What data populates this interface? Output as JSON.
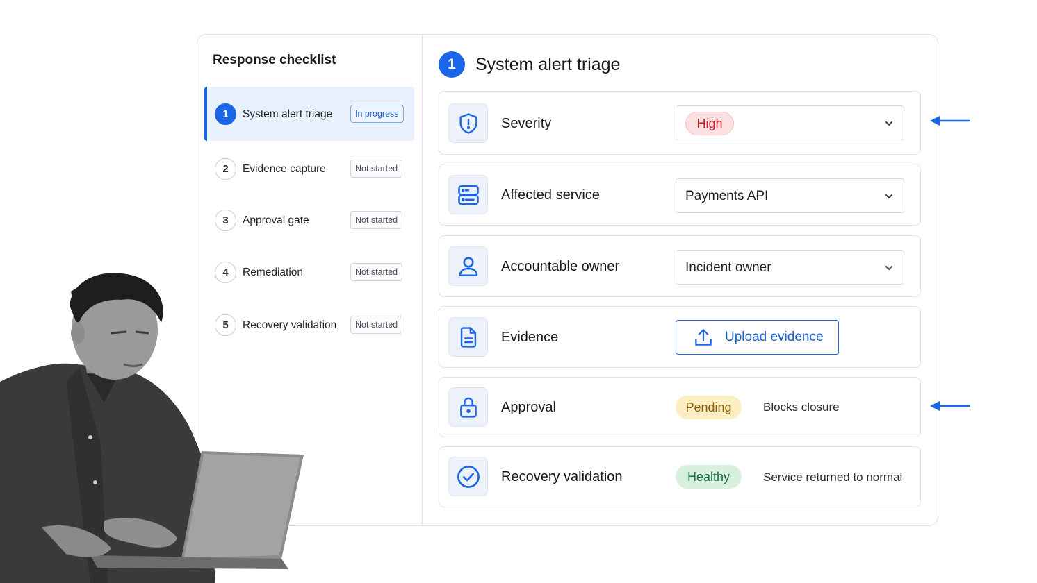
{
  "sidebar": {
    "title": "Response checklist",
    "steps": [
      {
        "num": "1",
        "label": "System alert triage",
        "status": "In progress"
      },
      {
        "num": "2",
        "label": "Evidence capture",
        "status": "Not started"
      },
      {
        "num": "3",
        "label": "Approval gate",
        "status": "Not started"
      },
      {
        "num": "4",
        "label": "Remediation",
        "status": "Not started"
      },
      {
        "num": "5",
        "label": "Recovery validation",
        "status": "Not started"
      }
    ]
  },
  "main": {
    "step_num": "1",
    "title": "System alert triage",
    "rows": {
      "severity": {
        "label": "Severity",
        "value": "High",
        "icon": "shield-alert-icon"
      },
      "service": {
        "label": "Affected service",
        "value": "Payments API",
        "icon": "server-icon"
      },
      "owner": {
        "label": "Accountable owner",
        "value": "Incident owner",
        "icon": "user-icon"
      },
      "evidence": {
        "label": "Evidence",
        "button": "Upload evidence",
        "icon": "document-icon"
      },
      "approval": {
        "label": "Approval",
        "status": "Pending",
        "note": "Blocks closure",
        "icon": "lock-icon"
      },
      "recovery": {
        "label": "Recovery validation",
        "status": "Healthy",
        "note": "Service returned to normal",
        "icon": "check-circle-icon"
      }
    }
  },
  "colors": {
    "accent": "#1a66e6",
    "high": "#c52323",
    "pending": "#8a5a00",
    "healthy": "#17703a"
  }
}
